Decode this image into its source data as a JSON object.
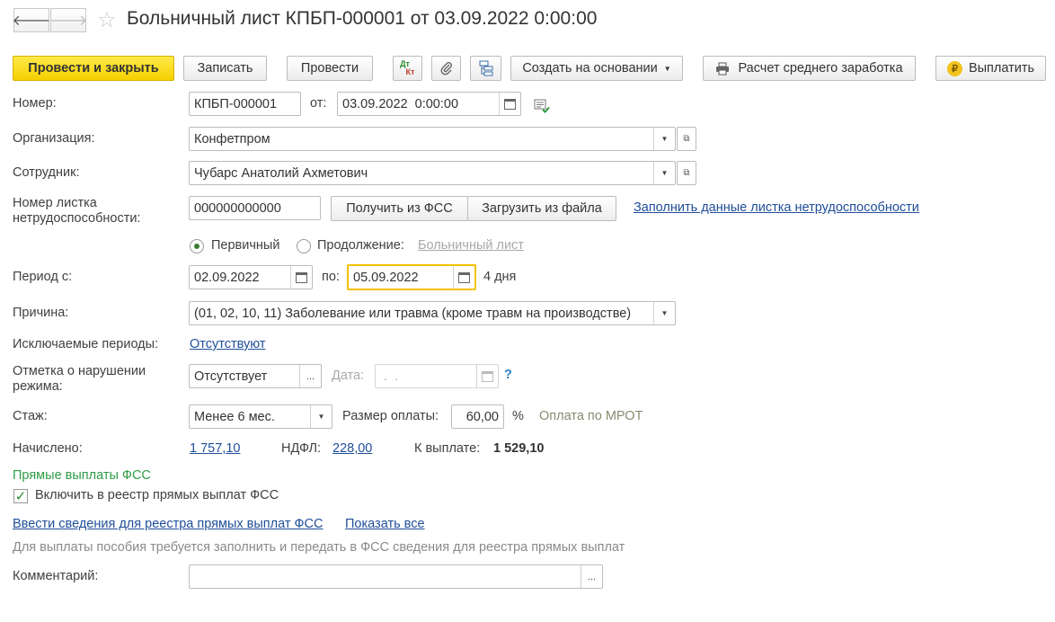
{
  "header": {
    "back_glyph": "🡐",
    "forward_glyph": "🡒",
    "star_glyph": "☆",
    "title": "Больничный лист КПБП-000001 от 03.09.2022 0:00:00"
  },
  "toolbar": {
    "post_close": "Провести и закрыть",
    "save": "Записать",
    "post": "Провести",
    "dtkt_top": "Дт",
    "dtkt_bottom": "Кт",
    "create_based": "Создать на основании",
    "avg_earnings": "Расчет среднего заработка",
    "pay": "Выплатить",
    "ruble_glyph": "₽"
  },
  "form": {
    "number_label": "Номер:",
    "number_value": "КПБП-000001",
    "date_label": "от:",
    "date_value": "03.09.2022  0:00:00",
    "org_label": "Организация:",
    "org_value": "Конфетпром",
    "employee_label": "Сотрудник:",
    "employee_value": "Чубарс Анатолий Ахметович",
    "sheet_label_1": "Номер листка",
    "sheet_label_2": "нетрудоспособности:",
    "sheet_value": "000000000000",
    "get_fss": "Получить из ФСС",
    "load_file": "Загрузить из файла",
    "fill_link": "Заполнить данные листка нетрудоспособности",
    "radio_primary": "Первичный",
    "radio_continuation": "Продолжение:",
    "sick_leave_link": "Больничный лист",
    "period_label": "Период с:",
    "period_from": "02.09.2022",
    "period_to_label": "по:",
    "period_to": "05.09.2022",
    "days": "4 дня",
    "reason_label": "Причина:",
    "reason_value": "(01, 02, 10, 11) Заболевание или травма (кроме травм на производстве)",
    "excluded_label": "Исключаемые периоды:",
    "excluded_link": "Отсутствуют",
    "violation_label_1": "Отметка о нарушении",
    "violation_label_2": "режима:",
    "violation_value": "Отсутствует",
    "ellipsis": "...",
    "viol_date_label": "Дата:",
    "viol_date_value": " .  .",
    "help": "?",
    "exp_label": "Стаж:",
    "exp_value": "Менее 6 мес.",
    "payment_size_label": "Размер оплаты:",
    "payment_size_value": "60,00",
    "percent": "%",
    "mrot_note": "Оплата по МРОТ",
    "accrued_label": "Начислено:",
    "accrued_value": "1 757,10",
    "ndfl_label": "НДФЛ:",
    "ndfl_value": "228,00",
    "to_pay_label": "К выплате:",
    "to_pay_value": "1 529,10",
    "direct_heading": "Прямые выплаты ФСС",
    "include_registry": "Включить в реестр прямых выплат ФСС",
    "include_checked": true,
    "enter_info_link": "Ввести сведения для реестра прямых выплат ФСС",
    "show_all_link": "Показать все",
    "info_note": "Для выплаты пособия требуется заполнить и передать в ФСС сведения для реестра прямых выплат",
    "comment_label": "Комментарий:",
    "comment_value": ""
  },
  "colors": {
    "primary_button": "#f5d000",
    "link": "#1f4e99",
    "section_heading": "#2e9b46",
    "focus_border": "#f5c100"
  }
}
